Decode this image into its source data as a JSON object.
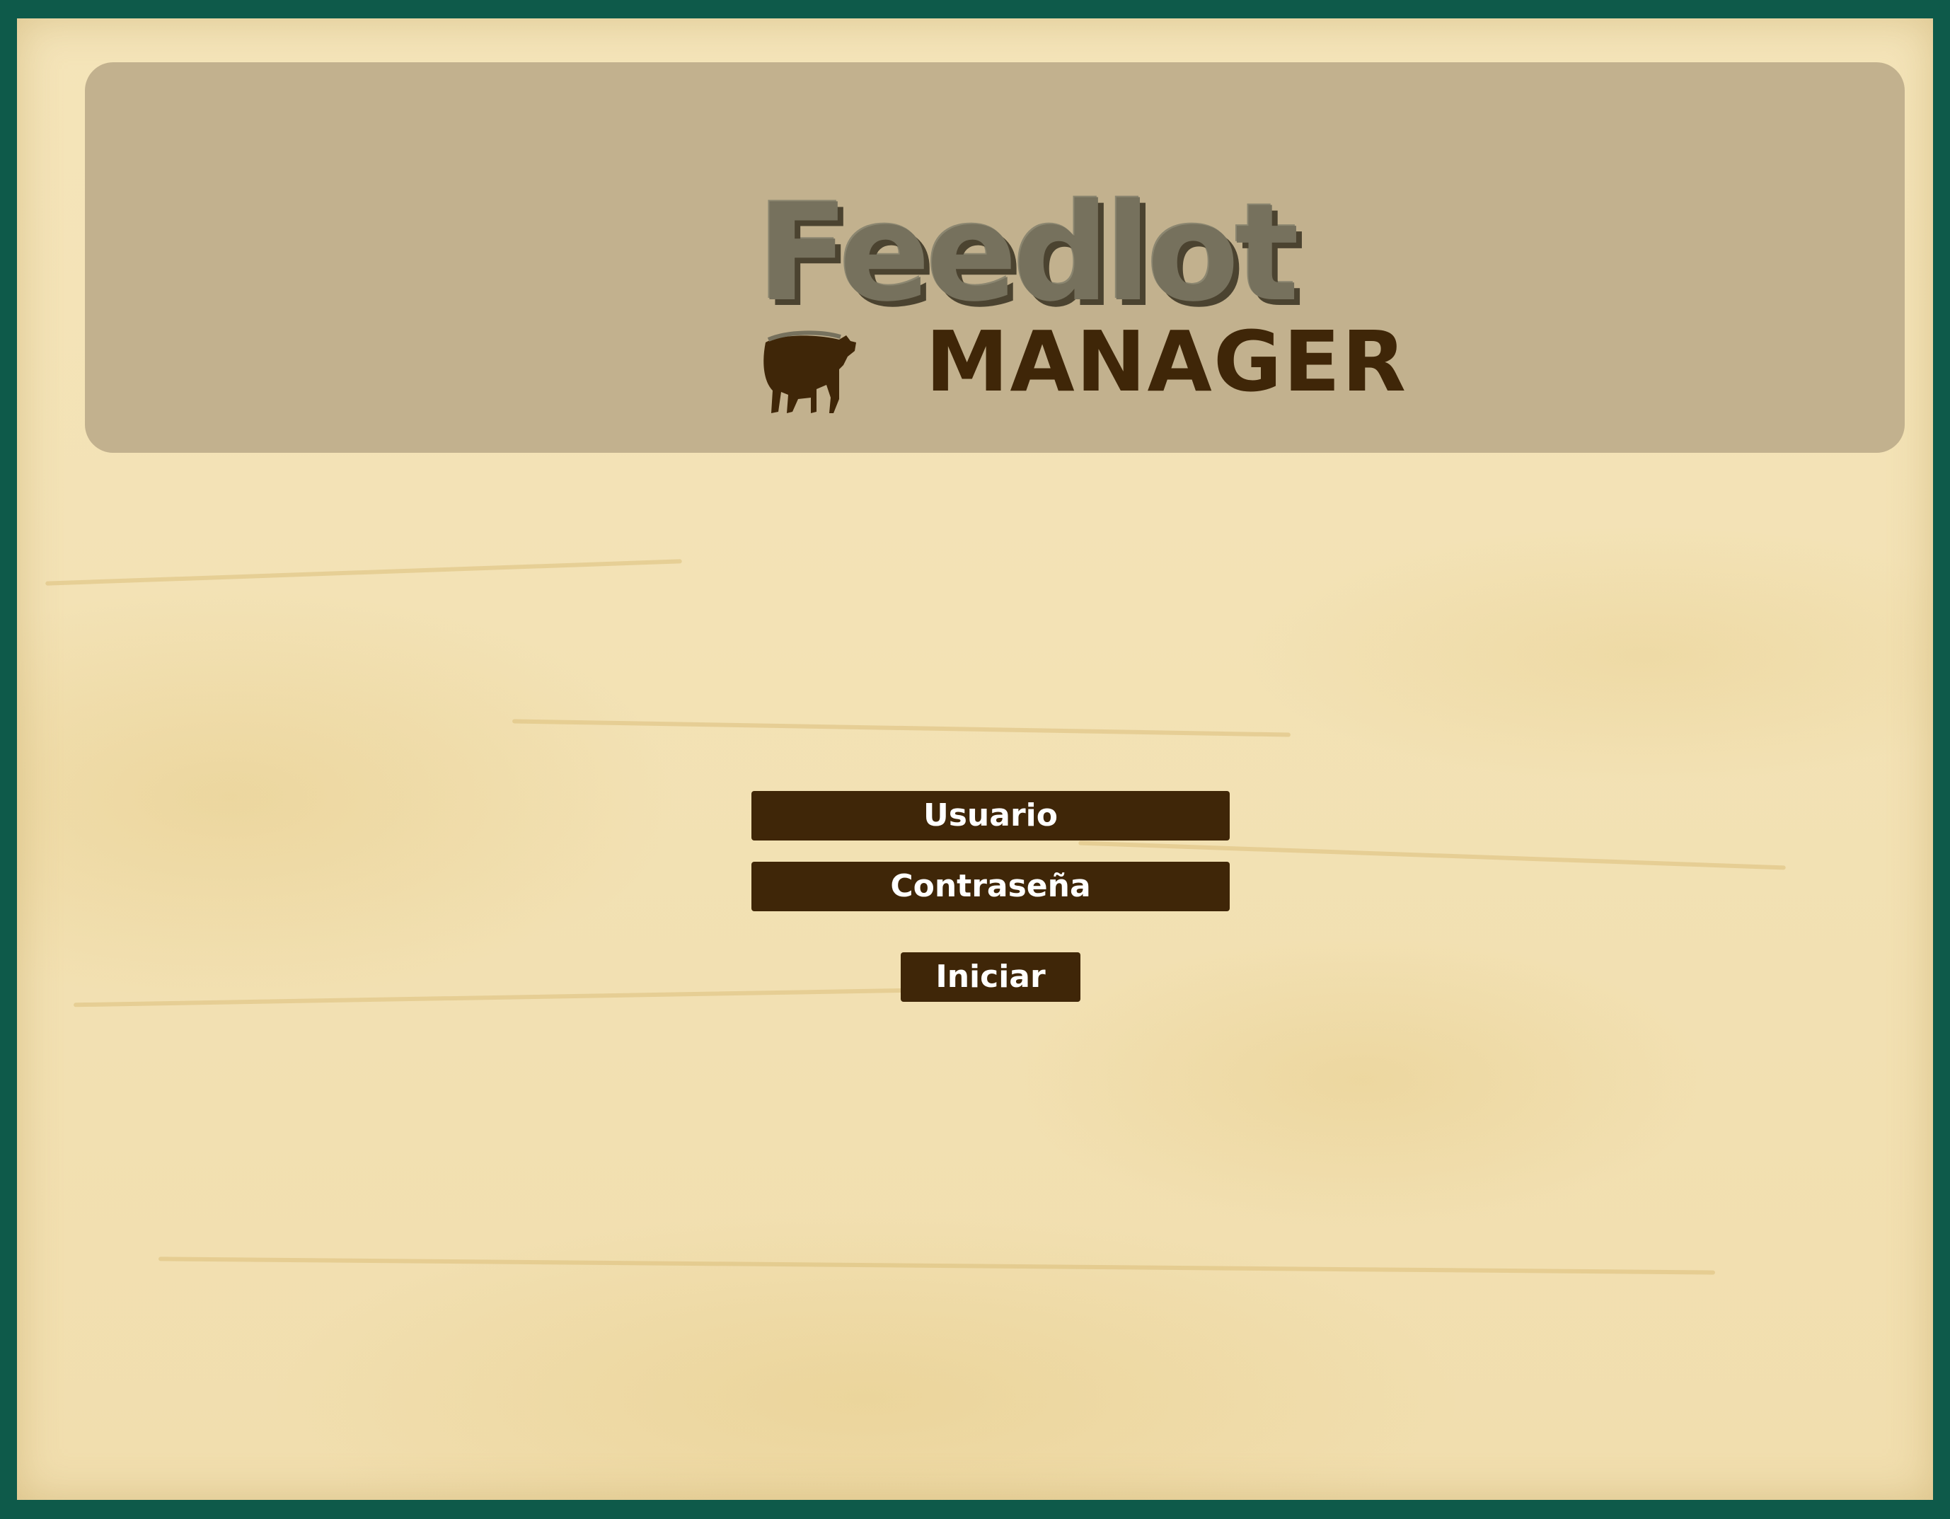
{
  "brand": {
    "title_word": "Feedlot",
    "subtitle_word": "MANAGER",
    "logo_icon": "cow-icon"
  },
  "login": {
    "username_label": "Usuario",
    "password_label": "Contraseña",
    "submit_label": "Iniciar"
  },
  "colors": {
    "frame_border": "#0e5a4a",
    "background": "#f4e4b9",
    "header_panel": "#c2b18e",
    "control_fill": "#3f2608",
    "control_text": "#ffffff",
    "logo_text": "#76715d"
  }
}
